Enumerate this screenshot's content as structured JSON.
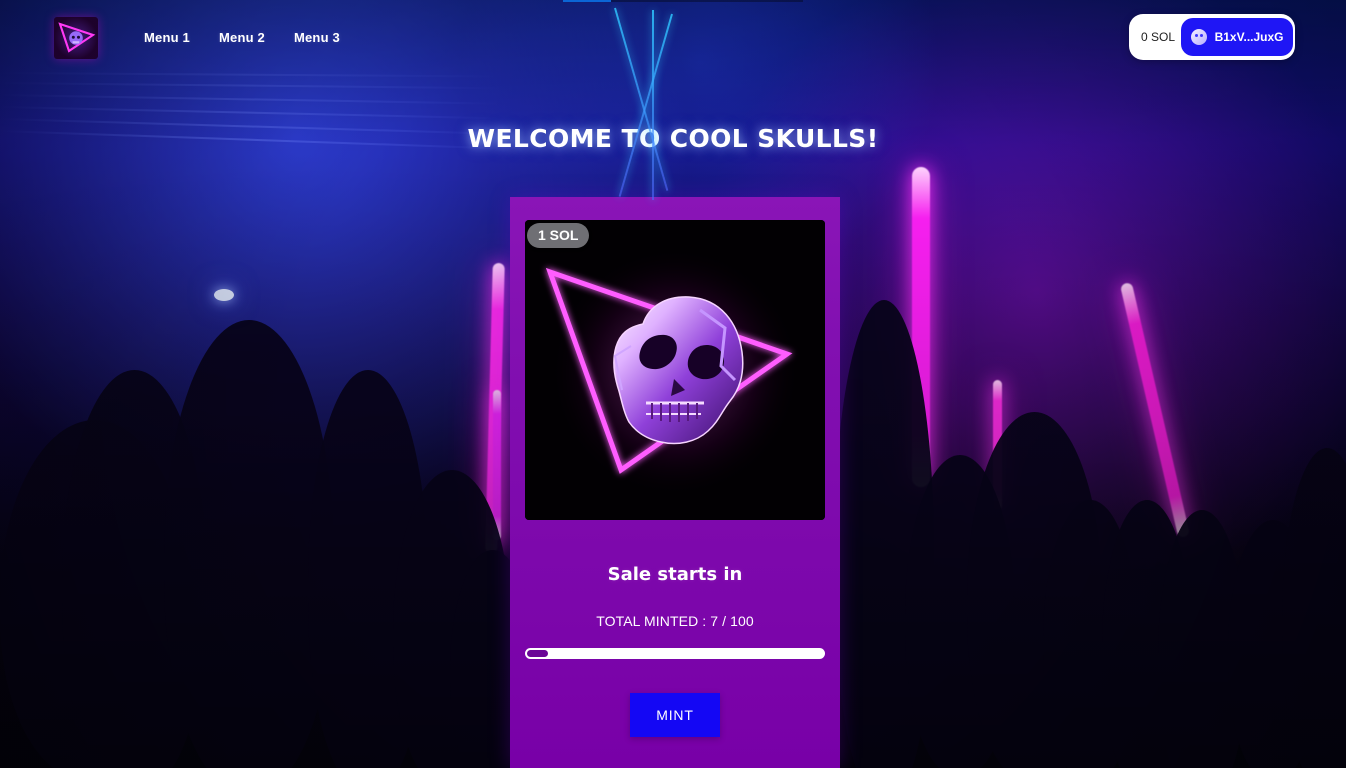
{
  "navbar": {
    "logo_icon": "skull-triangle-logo-icon",
    "menu": [
      {
        "label": "Menu 1"
      },
      {
        "label": "Menu 2"
      },
      {
        "label": "Menu 3"
      }
    ],
    "wallet": {
      "balance": "0 SOL",
      "address": "B1xV...JuxG",
      "icon": "phantom-ghost-icon",
      "accent_color": "#1f16f5"
    }
  },
  "hero": {
    "title": "WELCOME TO COOL SKULLS!"
  },
  "card": {
    "image_icon": "neon-skull-triangle-icon",
    "price_badge": "1 SOL",
    "sale_title": "Sale starts in",
    "minted_label": "TOTAL MINTED : 7 / 100",
    "minted_current": 7,
    "minted_total": 100,
    "progress_percent": 7,
    "mint_button_label": "MINT",
    "background_color": "#7800a7",
    "button_color": "#1407f4"
  }
}
